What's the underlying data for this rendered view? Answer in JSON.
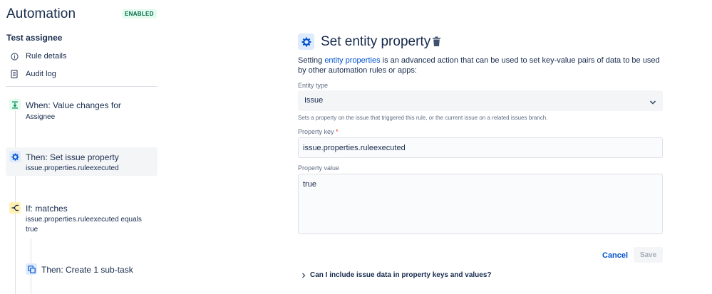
{
  "app": {
    "title": "Automation",
    "status_badge": "ENABLED"
  },
  "rule": {
    "name": "Test assignee"
  },
  "nav": [
    {
      "label": "Rule details",
      "icon": "info-icon"
    },
    {
      "label": "Audit log",
      "icon": "document-icon"
    }
  ],
  "steps": [
    {
      "title": "When: Value changes for",
      "detail": "Assignee",
      "icon": "trigger-icon"
    },
    {
      "title": "Then: Set issue property",
      "detail": "issue.properties.ruleexecuted",
      "icon": "gear-icon"
    },
    {
      "title": "If: matches",
      "detail": "issue.properties.ruleexecuted equals",
      "detail2": "true",
      "icon": "condition-branch-icon"
    },
    {
      "title": "Then: Create 1 sub-task",
      "icon": "subtask-icon"
    }
  ],
  "editor": {
    "title": "Set entity property",
    "desc_prefix": "Setting ",
    "desc_link": "entity properties",
    "desc_suffix": " is an advanced action that can be used to set key-value pairs of data to be used by other automation rules or apps:",
    "entity_type_label": "Entity type",
    "entity_type_value": "Issue",
    "entity_type_help": "Sets a property on the issue that triggered this rule, or the current issue on a related issues branch.",
    "property_key_label": "Property key",
    "property_key_required": "*",
    "property_key_value": "issue.properties.ruleexecuted",
    "property_value_label": "Property value",
    "property_value_value": "true",
    "cancel_label": "Cancel",
    "save_label": "Save",
    "faq_label": "Can I include issue data in property keys and values?"
  },
  "colors": {
    "accent": "#0052cc",
    "badge_bg": "#e3fcef",
    "badge_text": "#006644",
    "trigger": "#36b37e",
    "condition": "#ffc400",
    "action": "#0065ff"
  }
}
